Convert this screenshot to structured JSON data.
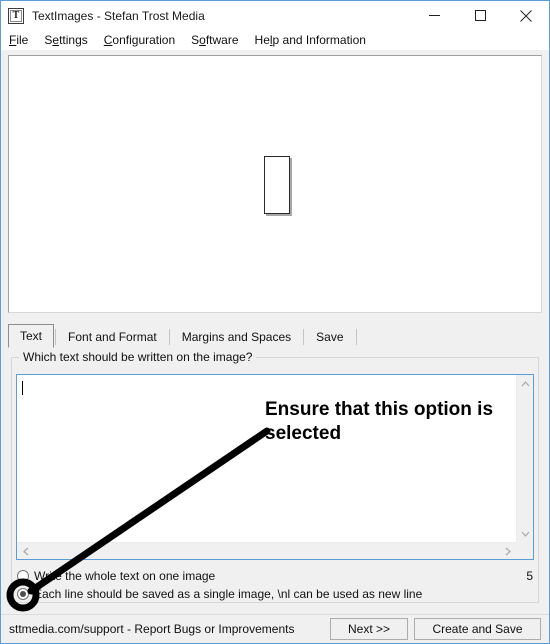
{
  "window": {
    "title": "TextImages - Stefan Trost Media",
    "icon": "text-image-app-icon",
    "icon_glyph": "T",
    "controls": {
      "minimize": "minimize-icon",
      "maximize": "maximize-icon",
      "close": "close-icon"
    }
  },
  "menu": {
    "items": [
      {
        "label": "File",
        "accel": "F"
      },
      {
        "label": "Settings",
        "accel": "e"
      },
      {
        "label": "Configuration",
        "accel": "C"
      },
      {
        "label": "Software",
        "accel": "o"
      },
      {
        "label": "Help and Information",
        "accel": "l"
      }
    ]
  },
  "preview": {
    "name": "image-preview-canvas",
    "background": "#ffffff",
    "thumbnail": "empty-image-placeholder"
  },
  "tabs": [
    {
      "label": "Text",
      "selected": true
    },
    {
      "label": "Font and Format",
      "selected": false
    },
    {
      "label": "Margins and Spaces",
      "selected": false
    },
    {
      "label": "Save",
      "selected": false
    }
  ],
  "group": {
    "label": "Which text should be written on the image?"
  },
  "editor": {
    "name": "text-input-area",
    "value": "",
    "placeholder": "",
    "focused": true,
    "focus_border_color": "#5b9dd9",
    "scroll_up_icon": "chevron-up-icon",
    "scroll_down_icon": "chevron-down-icon",
    "scroll_left_icon": "chevron-left-icon",
    "scroll_right_icon": "chevron-right-icon"
  },
  "options": {
    "one_image": {
      "label": "Write the whole text on one image",
      "checked": false
    },
    "per_line": {
      "label": "Each line should be saved as a single image, \\nl can be used as new line",
      "checked": true
    },
    "counter": "5"
  },
  "statusbar": {
    "text": "sttmedia.com/support - Report Bugs or Improvements",
    "next_label": "Next >>",
    "create_label": "Create and Save"
  },
  "annotation": {
    "text": "Ensure that this option is selected",
    "color": "#000000",
    "arrow": "arrow-to-selected-radio",
    "highlight": "circle-highlight-on-radio"
  }
}
